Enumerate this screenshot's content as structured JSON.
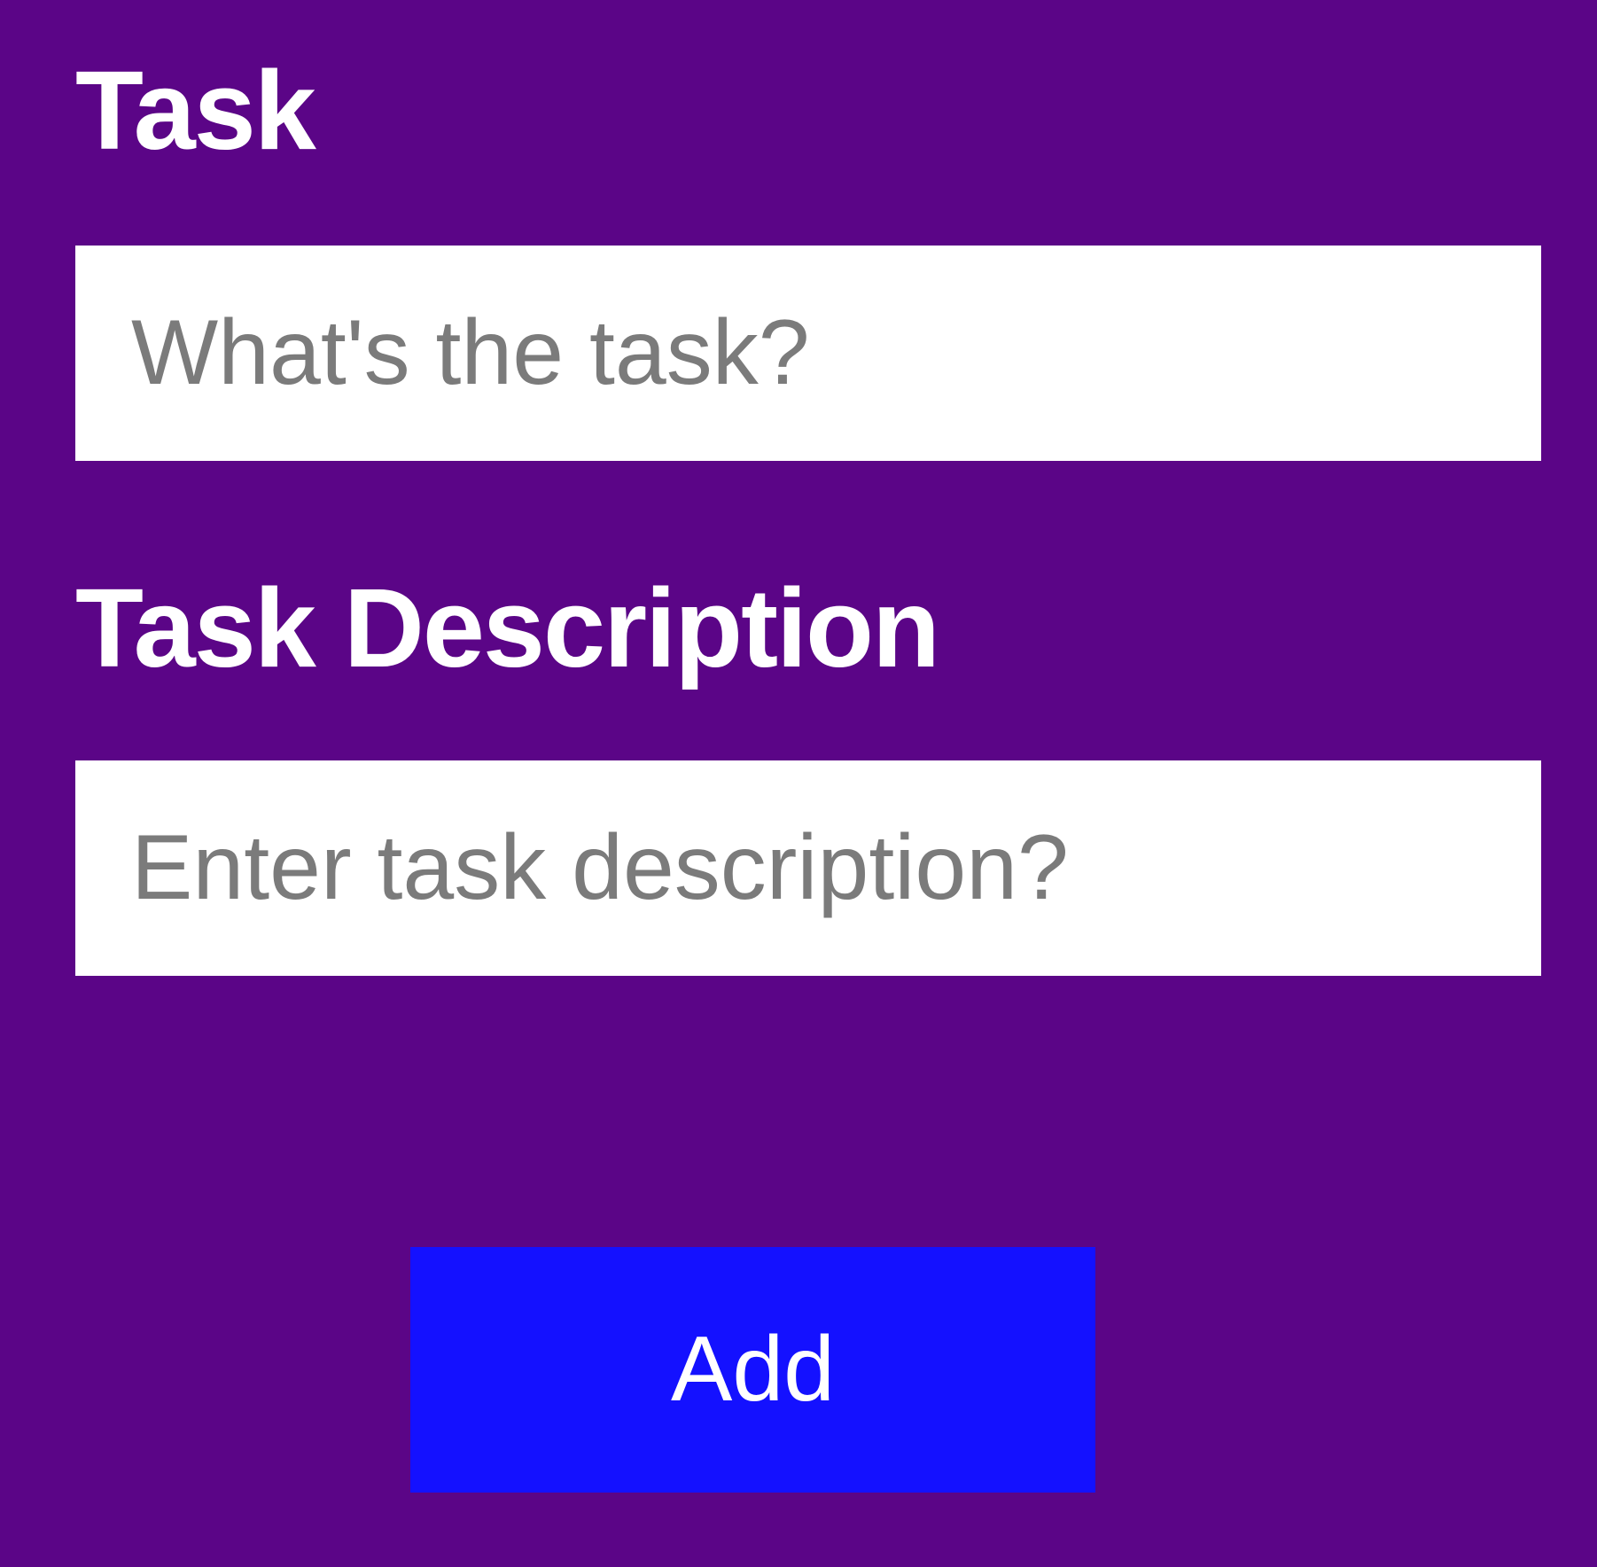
{
  "form": {
    "task_label": "Task",
    "task_placeholder": "What's the task?",
    "task_value": "",
    "description_label": "Task Description",
    "description_placeholder": "Enter task description?",
    "description_value": "",
    "add_button_label": "Add"
  },
  "colors": {
    "background": "#5b0587",
    "input_background": "#ffffff",
    "placeholder_text": "#7b7b7b",
    "label_text": "#ffffff",
    "button_background": "#1411ff",
    "button_text": "#ffffff"
  }
}
